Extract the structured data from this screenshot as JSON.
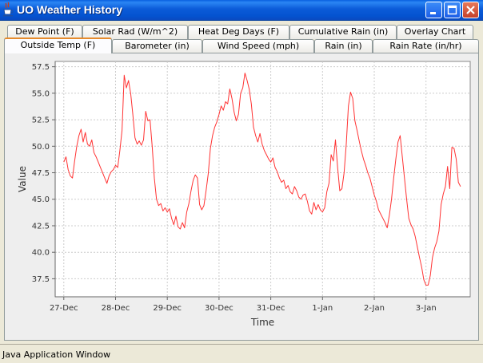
{
  "window": {
    "title": "UO Weather History",
    "buttons": {
      "minimize": "minimize",
      "maximize": "maximize",
      "close": "close"
    }
  },
  "tabs": {
    "row1": [
      "Dew Point (F)",
      "Solar Rad (W/m^2)",
      "Heat Deg Days (F)",
      "Cumulative Rain (in)",
      "Overlay Chart"
    ],
    "row2": [
      "Outside Temp (F)",
      "Barometer (in)",
      "Wind Speed (mph)",
      "Rain (in)",
      "Rain Rate (in/hr)"
    ],
    "selected": "Outside Temp (F)"
  },
  "chart_data": {
    "type": "line",
    "xlabel": "Time",
    "ylabel": "Value",
    "x_ticks": [
      "27-Dec",
      "28-Dec",
      "29-Dec",
      "30-Dec",
      "31-Dec",
      "1-Jan",
      "2-Jan",
      "3-Jan"
    ],
    "y_ticks": [
      "37.5",
      "40.0",
      "42.5",
      "45.0",
      "47.5",
      "50.0",
      "52.5",
      "55.0",
      "57.5"
    ],
    "ylim": [
      35.8,
      58
    ],
    "xlim": [
      "2008-12-26T20:00",
      "2009-01-03T20:30"
    ],
    "grid": true,
    "line_color": "#FF3333",
    "series": [
      {
        "points": [
          [
            "2008-12-27T00:00",
            48.5
          ],
          [
            "2008-12-27T01:00",
            49.0
          ],
          [
            "2008-12-27T02:00",
            47.8
          ],
          [
            "2008-12-27T03:00",
            47.2
          ],
          [
            "2008-12-27T04:00",
            47.0
          ],
          [
            "2008-12-27T05:00",
            48.6
          ],
          [
            "2008-12-27T06:00",
            50.0
          ],
          [
            "2008-12-27T07:00",
            51.0
          ],
          [
            "2008-12-27T08:00",
            51.6
          ],
          [
            "2008-12-27T09:00",
            50.4
          ],
          [
            "2008-12-27T10:00",
            51.3
          ],
          [
            "2008-12-27T11:00",
            50.2
          ],
          [
            "2008-12-27T12:00",
            50.0
          ],
          [
            "2008-12-27T13:00",
            50.6
          ],
          [
            "2008-12-27T14:00",
            49.4
          ],
          [
            "2008-12-27T15:00",
            49.0
          ],
          [
            "2008-12-27T16:00",
            48.5
          ],
          [
            "2008-12-27T17:00",
            48.0
          ],
          [
            "2008-12-27T18:00",
            47.5
          ],
          [
            "2008-12-27T19:00",
            47.0
          ],
          [
            "2008-12-27T20:00",
            46.5
          ],
          [
            "2008-12-27T21:00",
            47.2
          ],
          [
            "2008-12-27T22:00",
            47.6
          ],
          [
            "2008-12-27T23:00",
            47.8
          ],
          [
            "2008-12-28T00:00",
            48.2
          ],
          [
            "2008-12-28T01:00",
            48.0
          ],
          [
            "2008-12-28T02:00",
            49.6
          ],
          [
            "2008-12-28T03:00",
            51.5
          ],
          [
            "2008-12-28T04:00",
            56.7
          ],
          [
            "2008-12-28T05:00",
            55.5
          ],
          [
            "2008-12-28T06:00",
            56.2
          ],
          [
            "2008-12-28T07:00",
            55.0
          ],
          [
            "2008-12-28T08:00",
            53.0
          ],
          [
            "2008-12-28T09:00",
            50.8
          ],
          [
            "2008-12-28T10:00",
            50.2
          ],
          [
            "2008-12-28T11:00",
            50.5
          ],
          [
            "2008-12-28T12:00",
            50.1
          ],
          [
            "2008-12-28T13:00",
            50.6
          ],
          [
            "2008-12-28T14:00",
            53.3
          ],
          [
            "2008-12-28T15:00",
            52.4
          ],
          [
            "2008-12-28T16:00",
            52.5
          ],
          [
            "2008-12-28T17:00",
            50.0
          ],
          [
            "2008-12-28T18:00",
            47.0
          ],
          [
            "2008-12-28T19:00",
            45.0
          ],
          [
            "2008-12-28T20:00",
            44.4
          ],
          [
            "2008-12-28T21:00",
            44.6
          ],
          [
            "2008-12-28T22:00",
            43.9
          ],
          [
            "2008-12-28T23:00",
            44.2
          ],
          [
            "2008-12-29T00:00",
            43.8
          ],
          [
            "2008-12-29T01:00",
            44.1
          ],
          [
            "2008-12-29T02:00",
            43.2
          ],
          [
            "2008-12-29T03:00",
            42.6
          ],
          [
            "2008-12-29T04:00",
            43.4
          ],
          [
            "2008-12-29T05:00",
            42.4
          ],
          [
            "2008-12-29T06:00",
            42.2
          ],
          [
            "2008-12-29T07:00",
            42.8
          ],
          [
            "2008-12-29T08:00",
            42.3
          ],
          [
            "2008-12-29T09:00",
            43.8
          ],
          [
            "2008-12-29T10:00",
            44.6
          ],
          [
            "2008-12-29T11:00",
            45.8
          ],
          [
            "2008-12-29T12:00",
            46.8
          ],
          [
            "2008-12-29T13:00",
            47.3
          ],
          [
            "2008-12-29T14:00",
            47.0
          ],
          [
            "2008-12-29T15:00",
            44.5
          ],
          [
            "2008-12-29T16:00",
            44.0
          ],
          [
            "2008-12-29T17:00",
            44.4
          ],
          [
            "2008-12-29T18:00",
            45.8
          ],
          [
            "2008-12-29T19:00",
            47.4
          ],
          [
            "2008-12-29T20:00",
            49.8
          ],
          [
            "2008-12-29T21:00",
            51.0
          ],
          [
            "2008-12-29T22:00",
            51.8
          ],
          [
            "2008-12-29T23:00",
            52.3
          ],
          [
            "2008-12-30T00:00",
            53.0
          ],
          [
            "2008-12-30T01:00",
            53.8
          ],
          [
            "2008-12-30T02:00",
            53.4
          ],
          [
            "2008-12-30T03:00",
            54.2
          ],
          [
            "2008-12-30T04:00",
            54.0
          ],
          [
            "2008-12-30T05:00",
            55.4
          ],
          [
            "2008-12-30T06:00",
            54.5
          ],
          [
            "2008-12-30T07:00",
            53.2
          ],
          [
            "2008-12-30T08:00",
            52.4
          ],
          [
            "2008-12-30T09:00",
            53.0
          ],
          [
            "2008-12-30T10:00",
            55.0
          ],
          [
            "2008-12-30T11:00",
            55.5
          ],
          [
            "2008-12-30T12:00",
            56.9
          ],
          [
            "2008-12-30T13:00",
            56.2
          ],
          [
            "2008-12-30T14:00",
            55.4
          ],
          [
            "2008-12-30T15:00",
            54.0
          ],
          [
            "2008-12-30T16:00",
            51.8
          ],
          [
            "2008-12-30T17:00",
            51.0
          ],
          [
            "2008-12-30T18:00",
            50.4
          ],
          [
            "2008-12-30T19:00",
            51.2
          ],
          [
            "2008-12-30T20:00",
            50.2
          ],
          [
            "2008-12-30T21:00",
            49.6
          ],
          [
            "2008-12-30T22:00",
            49.2
          ],
          [
            "2008-12-30T23:00",
            48.8
          ],
          [
            "2008-12-31T00:00",
            48.5
          ],
          [
            "2008-12-31T01:00",
            48.9
          ],
          [
            "2008-12-31T02:00",
            48.0
          ],
          [
            "2008-12-31T03:00",
            47.6
          ],
          [
            "2008-12-31T04:00",
            47.0
          ],
          [
            "2008-12-31T05:00",
            46.6
          ],
          [
            "2008-12-31T06:00",
            46.8
          ],
          [
            "2008-12-31T07:00",
            46.0
          ],
          [
            "2008-12-31T08:00",
            46.3
          ],
          [
            "2008-12-31T09:00",
            45.7
          ],
          [
            "2008-12-31T10:00",
            45.5
          ],
          [
            "2008-12-31T11:00",
            46.2
          ],
          [
            "2008-12-31T12:00",
            45.8
          ],
          [
            "2008-12-31T13:00",
            45.2
          ],
          [
            "2008-12-31T14:00",
            45.0
          ],
          [
            "2008-12-31T15:00",
            45.4
          ],
          [
            "2008-12-31T16:00",
            45.5
          ],
          [
            "2008-12-31T17:00",
            44.8
          ],
          [
            "2008-12-31T18:00",
            43.9
          ],
          [
            "2008-12-31T19:00",
            43.6
          ],
          [
            "2008-12-31T20:00",
            44.7
          ],
          [
            "2008-12-31T21:00",
            44.0
          ],
          [
            "2008-12-31T22:00",
            44.5
          ],
          [
            "2008-12-31T23:00",
            44.0
          ],
          [
            "2009-01-01T00:00",
            43.8
          ],
          [
            "2009-01-01T01:00",
            44.2
          ],
          [
            "2009-01-01T02:00",
            45.7
          ],
          [
            "2009-01-01T03:00",
            46.5
          ],
          [
            "2009-01-01T04:00",
            49.2
          ],
          [
            "2009-01-01T05:00",
            48.6
          ],
          [
            "2009-01-01T06:00",
            50.6
          ],
          [
            "2009-01-01T07:00",
            48.0
          ],
          [
            "2009-01-01T08:00",
            45.8
          ],
          [
            "2009-01-01T09:00",
            46.0
          ],
          [
            "2009-01-01T10:00",
            47.5
          ],
          [
            "2009-01-01T11:00",
            50.2
          ],
          [
            "2009-01-01T12:00",
            53.8
          ],
          [
            "2009-01-01T13:00",
            55.1
          ],
          [
            "2009-01-01T14:00",
            54.5
          ],
          [
            "2009-01-01T15:00",
            52.4
          ],
          [
            "2009-01-01T16:00",
            51.5
          ],
          [
            "2009-01-01T17:00",
            50.5
          ],
          [
            "2009-01-01T18:00",
            49.6
          ],
          [
            "2009-01-01T19:00",
            48.8
          ],
          [
            "2009-01-01T20:00",
            48.2
          ],
          [
            "2009-01-01T21:00",
            47.5
          ],
          [
            "2009-01-01T22:00",
            47.0
          ],
          [
            "2009-01-01T23:00",
            46.2
          ],
          [
            "2009-01-02T00:00",
            45.4
          ],
          [
            "2009-01-02T01:00",
            44.8
          ],
          [
            "2009-01-02T02:00",
            44.0
          ],
          [
            "2009-01-02T03:00",
            43.6
          ],
          [
            "2009-01-02T04:00",
            43.2
          ],
          [
            "2009-01-02T05:00",
            42.8
          ],
          [
            "2009-01-02T06:00",
            42.3
          ],
          [
            "2009-01-02T07:00",
            43.5
          ],
          [
            "2009-01-02T08:00",
            45.0
          ],
          [
            "2009-01-02T09:00",
            47.0
          ],
          [
            "2009-01-02T10:00",
            48.8
          ],
          [
            "2009-01-02T11:00",
            50.4
          ],
          [
            "2009-01-02T12:00",
            51.0
          ],
          [
            "2009-01-02T13:00",
            49.0
          ],
          [
            "2009-01-02T14:00",
            47.0
          ],
          [
            "2009-01-02T15:00",
            45.0
          ],
          [
            "2009-01-02T16:00",
            43.2
          ],
          [
            "2009-01-02T17:00",
            42.6
          ],
          [
            "2009-01-02T18:00",
            42.2
          ],
          [
            "2009-01-02T19:00",
            41.5
          ],
          [
            "2009-01-02T20:00",
            40.5
          ],
          [
            "2009-01-02T21:00",
            39.5
          ],
          [
            "2009-01-02T22:00",
            38.6
          ],
          [
            "2009-01-02T23:00",
            37.4
          ],
          [
            "2009-01-03T00:00",
            36.9
          ],
          [
            "2009-01-03T01:00",
            36.9
          ],
          [
            "2009-01-03T02:00",
            37.8
          ],
          [
            "2009-01-03T03:00",
            39.5
          ],
          [
            "2009-01-03T04:00",
            40.4
          ],
          [
            "2009-01-03T05:00",
            41.0
          ],
          [
            "2009-01-03T06:00",
            42.0
          ],
          [
            "2009-01-03T07:00",
            44.5
          ],
          [
            "2009-01-03T08:00",
            45.5
          ],
          [
            "2009-01-03T09:00",
            46.2
          ],
          [
            "2009-01-03T10:00",
            48.1
          ],
          [
            "2009-01-03T11:00",
            46.0
          ],
          [
            "2009-01-03T12:00",
            49.9
          ],
          [
            "2009-01-03T13:00",
            49.8
          ],
          [
            "2009-01-03T14:00",
            48.8
          ],
          [
            "2009-01-03T15:00",
            46.6
          ],
          [
            "2009-01-03T16:00",
            46.2
          ]
        ]
      }
    ]
  },
  "statusbar": {
    "text": "Java Application Window"
  }
}
